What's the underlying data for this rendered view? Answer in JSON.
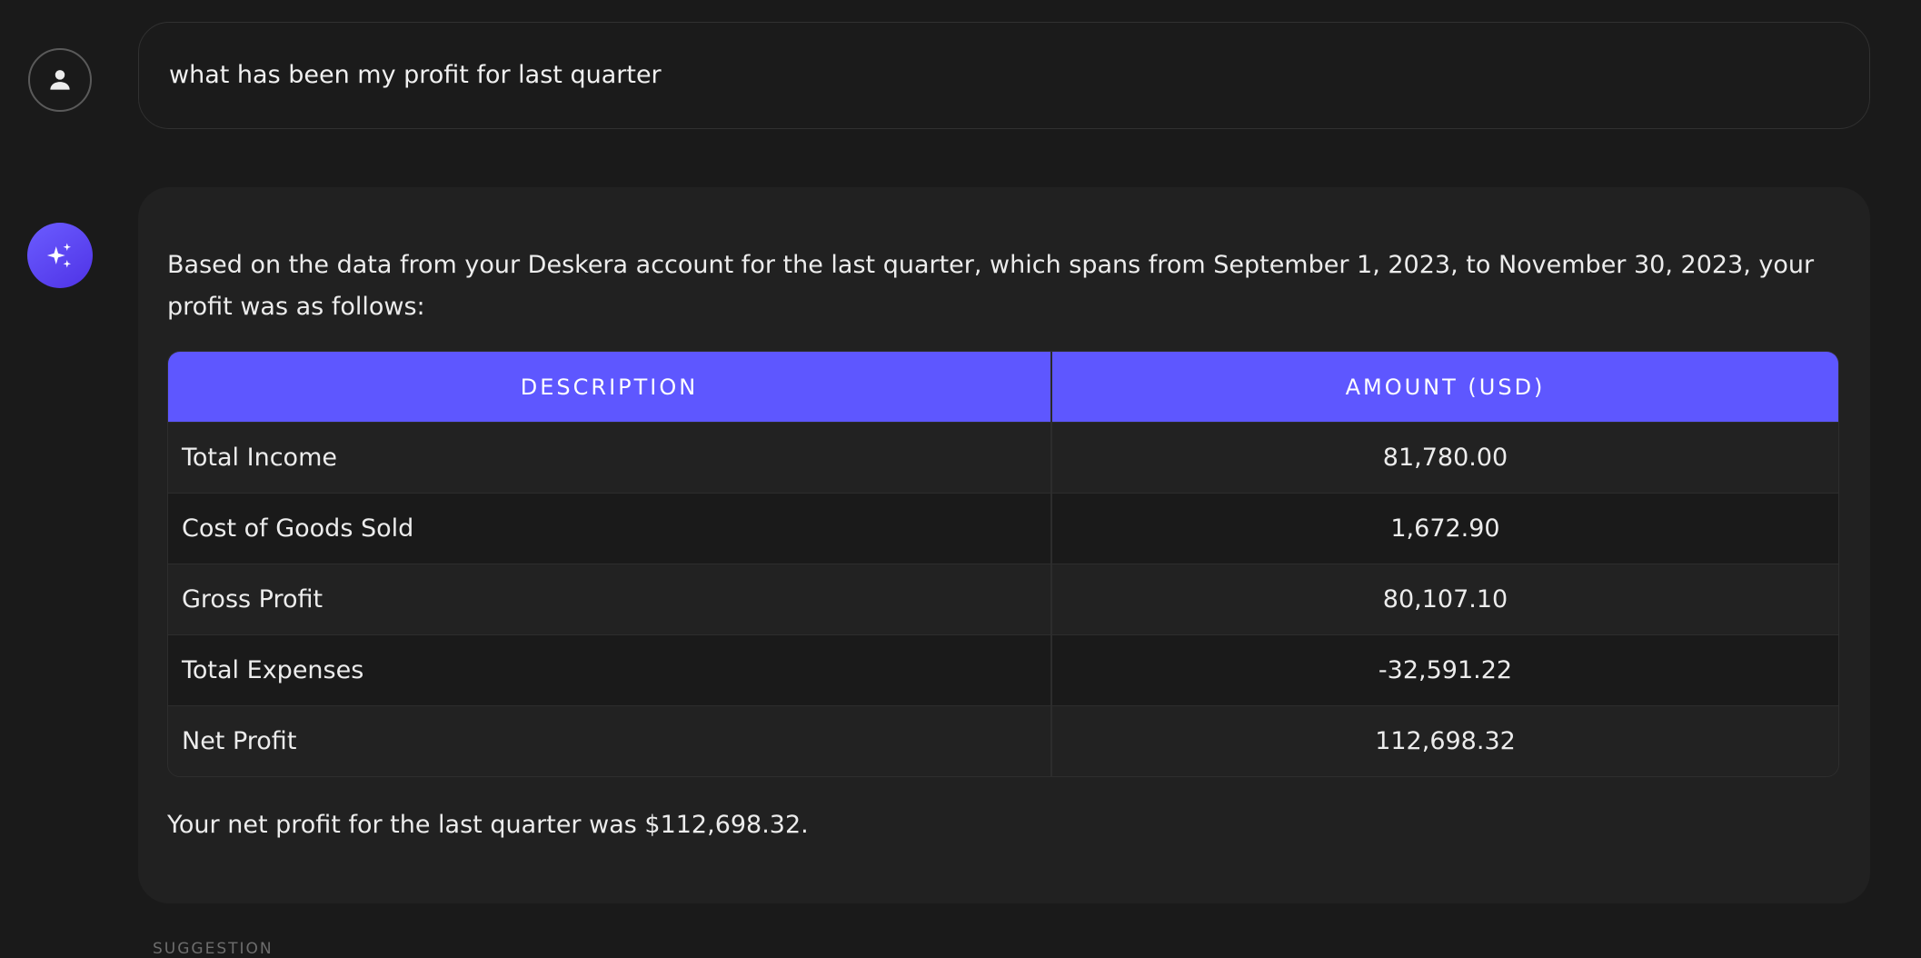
{
  "user_message": {
    "avatar_icon": "user-icon",
    "text": "what has been my profit for last quarter"
  },
  "ai_message": {
    "avatar_icon": "sparkle-icon",
    "intro": "Based on the data from your Deskera account for the last quarter, which spans from September 1, 2023, to November 30, 2023, your profit was as follows:",
    "table": {
      "headers": [
        "DESCRIPTION",
        "AMOUNT (USD)"
      ],
      "rows": [
        {
          "description": "Total Income",
          "amount": "81,780.00"
        },
        {
          "description": "Cost of Goods Sold",
          "amount": "1,672.90"
        },
        {
          "description": "Gross Profit",
          "amount": "80,107.10"
        },
        {
          "description": "Total Expenses",
          "amount": "-32,591.22"
        },
        {
          "description": "Net Profit",
          "amount": "112,698.32"
        }
      ]
    },
    "summary": "Your net profit for the last quarter was $112,698.32."
  },
  "suggestion_label": "SUGGESTION",
  "colors": {
    "background": "#1a1a1a",
    "card": "#212121",
    "accent": "#5e57ff"
  }
}
